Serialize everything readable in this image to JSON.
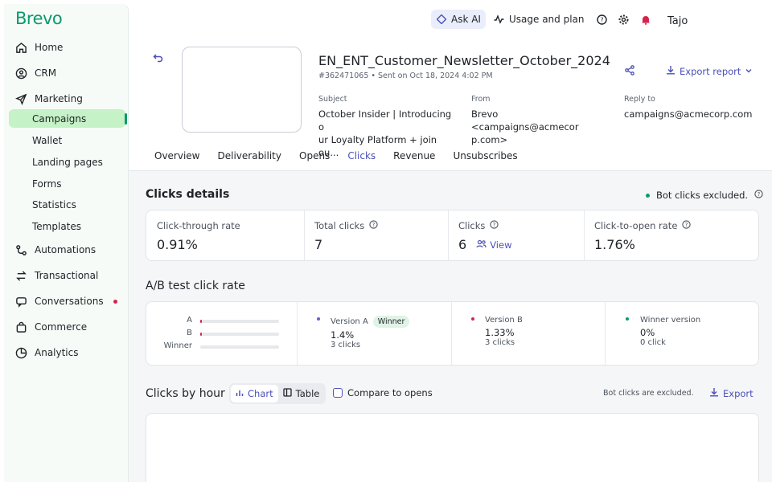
{
  "brand": {
    "logo": "Brevo",
    "accent": "#0b996e",
    "link_color": "#4b4fb8",
    "alert_color": "#d6234e"
  },
  "sidebar": {
    "items": [
      {
        "label": "Home",
        "icon": "home-icon"
      },
      {
        "label": "CRM",
        "icon": "contacts-icon"
      },
      {
        "label": "Marketing",
        "icon": "paper-plane-icon"
      },
      {
        "label": "Automations",
        "icon": "workflow-icon"
      },
      {
        "label": "Transactional",
        "icon": "arrows-swap-icon"
      },
      {
        "label": "Conversations",
        "icon": "chat-icon"
      },
      {
        "label": "Commerce",
        "icon": "bag-icon"
      },
      {
        "label": "Analytics",
        "icon": "pie-chart-icon"
      }
    ],
    "marketing_sub": [
      {
        "label": "Campaigns"
      },
      {
        "label": "Wallet"
      },
      {
        "label": "Landing pages"
      },
      {
        "label": "Forms"
      },
      {
        "label": "Statistics"
      },
      {
        "label": "Templates"
      }
    ]
  },
  "topbar": {
    "ask_ai": "Ask AI",
    "usage": "Usage and plan",
    "user": "Tajo"
  },
  "campaign": {
    "name": "EN_ENT_Customer_Newsletter_October_2024",
    "id": "#362471065",
    "sent": "Sent on Oct 18, 2024 4:02 PM",
    "export_label": "Export report",
    "subject_label": "Subject",
    "subject_line1": "October Insider | Introducing o",
    "subject_line2": "ur Loyalty Platform + join ou...",
    "from_label": "From",
    "from_line1": "Brevo <campaigns@acmecor",
    "from_line2": "p.com>",
    "reply_label": "Reply to",
    "reply_value": "campaigns@acmecorp.com"
  },
  "tabs": [
    {
      "label": "Overview"
    },
    {
      "label": "Deliverability"
    },
    {
      "label": "Opens"
    },
    {
      "label": "Clicks"
    },
    {
      "label": "Revenue"
    },
    {
      "label": "Unsubscribes"
    }
  ],
  "clicks": {
    "title": "Clicks details",
    "bot_note": "Bot clicks excluded.",
    "kpis": [
      {
        "label": "Click-through rate",
        "value": "0.91%"
      },
      {
        "label": "Total clicks",
        "value": "7"
      },
      {
        "label": "Clicks",
        "value": "6",
        "link": "View"
      },
      {
        "label": "Click-to-open rate",
        "value": "1.76%"
      }
    ]
  },
  "ab": {
    "title": "A/B test click rate",
    "bars": [
      {
        "label": "A",
        "rate": 0.014
      },
      {
        "label": "B",
        "rate": 0.0133
      },
      {
        "label": "Winner",
        "rate": 0
      }
    ],
    "versions": [
      {
        "name": "Version A",
        "badge": "Winner",
        "rate": "1.4%",
        "clicks": "3 clicks",
        "color": "#6b5bd6"
      },
      {
        "name": "Version B",
        "rate": "1.33%",
        "clicks": "3 clicks",
        "color": "#d6234e"
      },
      {
        "name": "Winner version",
        "rate": "0%",
        "clicks": "0 click",
        "color": "#0b996e"
      }
    ]
  },
  "by_hour": {
    "title": "Clicks by hour",
    "chart_label": "Chart",
    "table_label": "Table",
    "compare_label": "Compare to opens",
    "bot_note": "Bot clicks are excluded.",
    "export_label": "Export"
  }
}
